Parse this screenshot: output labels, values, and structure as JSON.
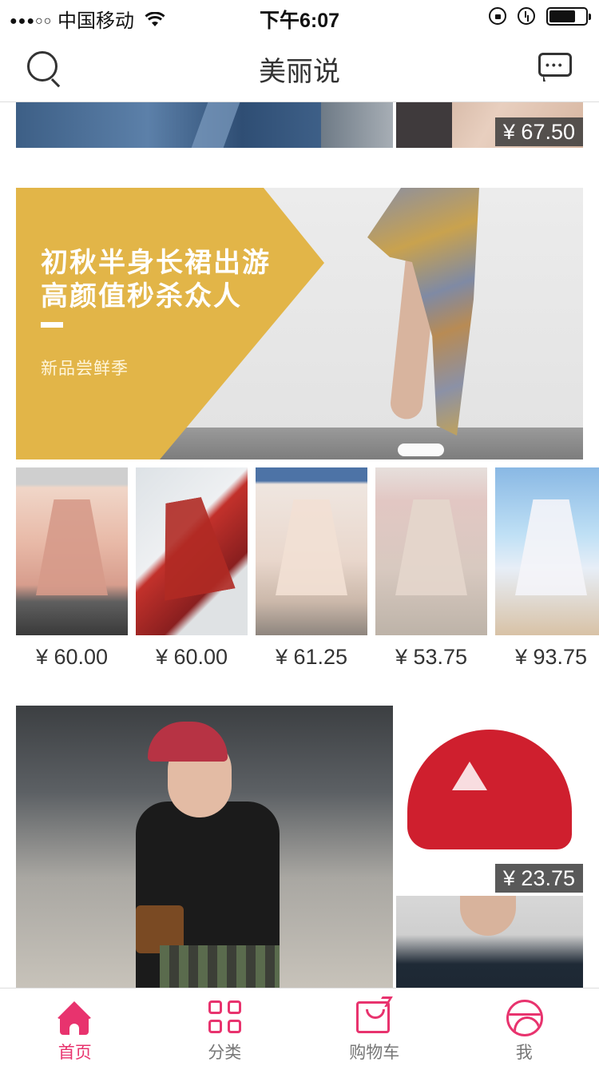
{
  "status_bar": {
    "signal": "●●●○○",
    "carrier": "中国移动",
    "wifi_icon": "wifi-icon",
    "time": "下午6:07",
    "battery_level": 0.72
  },
  "nav": {
    "title": "美丽说"
  },
  "feed": {
    "top_row": {
      "right_price": "¥ 67.50"
    },
    "banner": {
      "headline_line1": "初秋半身长裙出游",
      "headline_line2": "高颜值秒杀众人",
      "subtitle": "新品尝鲜季",
      "accent_color": "#e2b548"
    },
    "products": [
      {
        "price": "¥ 60.00"
      },
      {
        "price": "¥ 60.00"
      },
      {
        "price": "¥ 61.25"
      },
      {
        "price": "¥ 53.75"
      },
      {
        "price": "¥ 93.75"
      }
    ],
    "bottom_row": {
      "cap_price": "¥ 23.75"
    }
  },
  "tab_bar": {
    "accent_color": "#e8336e",
    "tabs": [
      {
        "label": "首页",
        "icon": "home-icon",
        "active": true
      },
      {
        "label": "分类",
        "icon": "grid-icon",
        "active": false
      },
      {
        "label": "购物车",
        "icon": "shopping-bag-icon",
        "active": false
      },
      {
        "label": "我",
        "icon": "profile-icon",
        "active": false
      }
    ]
  }
}
